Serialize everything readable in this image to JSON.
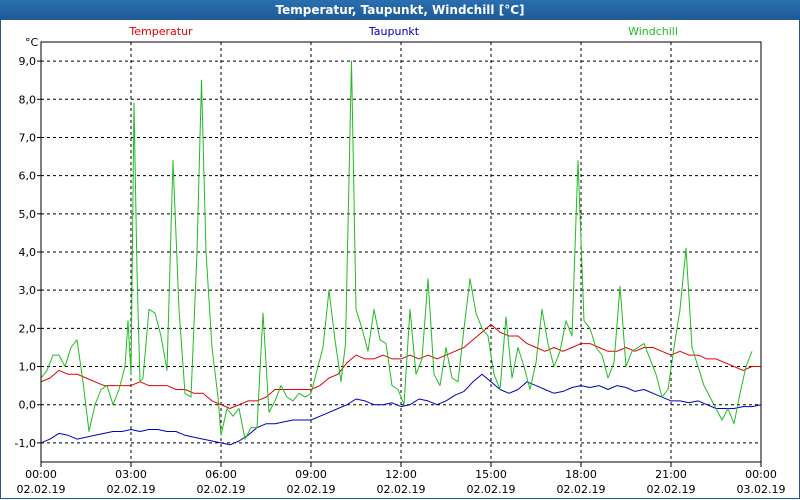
{
  "window": {
    "title": "Temperatur, Taupunkt, Windchill [°C]"
  },
  "chart_data": {
    "type": "line",
    "title": "Temperatur, Taupunkt, Windchill [°C]",
    "ylabel": "°C",
    "ylim": [
      -1.5,
      9.5
    ],
    "yticks": [
      "-1,0",
      "0,0",
      "1,0",
      "2,0",
      "3,0",
      "4,0",
      "5,0",
      "6,0",
      "7,0",
      "8,0",
      "9,0"
    ],
    "xlim": [
      0,
      24
    ],
    "x_ticks": [
      {
        "x": 0,
        "time": "00:00",
        "date": "02.02.19"
      },
      {
        "x": 3,
        "time": "03:00",
        "date": "02.02.19"
      },
      {
        "x": 6,
        "time": "06:00",
        "date": "02.02.19"
      },
      {
        "x": 9,
        "time": "09:00",
        "date": "02.02.19"
      },
      {
        "x": 12,
        "time": "12:00",
        "date": "02.02.19"
      },
      {
        "x": 15,
        "time": "15:00",
        "date": "02.02.19"
      },
      {
        "x": 18,
        "time": "18:00",
        "date": "02.02.19"
      },
      {
        "x": 21,
        "time": "21:00",
        "date": "02.02.19"
      },
      {
        "x": 24,
        "time": "00:00",
        "date": "03.02.19"
      }
    ],
    "grid": true,
    "legend_position": "top",
    "series": [
      {
        "name": "Temperatur",
        "color": "#e00000",
        "points": [
          [
            0,
            0.6
          ],
          [
            0.3,
            0.7
          ],
          [
            0.6,
            0.9
          ],
          [
            0.9,
            0.8
          ],
          [
            1.2,
            0.8
          ],
          [
            1.5,
            0.7
          ],
          [
            1.8,
            0.6
          ],
          [
            2.1,
            0.5
          ],
          [
            2.4,
            0.5
          ],
          [
            2.7,
            0.5
          ],
          [
            3.0,
            0.5
          ],
          [
            3.3,
            0.6
          ],
          [
            3.6,
            0.5
          ],
          [
            3.9,
            0.5
          ],
          [
            4.2,
            0.5
          ],
          [
            4.5,
            0.4
          ],
          [
            4.8,
            0.4
          ],
          [
            5.1,
            0.3
          ],
          [
            5.4,
            0.3
          ],
          [
            5.7,
            0.1
          ],
          [
            6.0,
            0.0
          ],
          [
            6.3,
            -0.1
          ],
          [
            6.6,
            0.0
          ],
          [
            6.9,
            0.1
          ],
          [
            7.2,
            0.1
          ],
          [
            7.5,
            0.2
          ],
          [
            7.8,
            0.4
          ],
          [
            8.1,
            0.4
          ],
          [
            8.4,
            0.4
          ],
          [
            8.7,
            0.4
          ],
          [
            9.0,
            0.4
          ],
          [
            9.3,
            0.5
          ],
          [
            9.6,
            0.7
          ],
          [
            9.9,
            0.8
          ],
          [
            10.2,
            1.1
          ],
          [
            10.5,
            1.3
          ],
          [
            10.8,
            1.2
          ],
          [
            11.1,
            1.2
          ],
          [
            11.4,
            1.3
          ],
          [
            11.7,
            1.2
          ],
          [
            12.0,
            1.2
          ],
          [
            12.3,
            1.3
          ],
          [
            12.6,
            1.2
          ],
          [
            12.9,
            1.3
          ],
          [
            13.2,
            1.2
          ],
          [
            13.5,
            1.3
          ],
          [
            13.8,
            1.4
          ],
          [
            14.1,
            1.5
          ],
          [
            14.4,
            1.7
          ],
          [
            14.7,
            1.9
          ],
          [
            15.0,
            2.1
          ],
          [
            15.3,
            1.9
          ],
          [
            15.6,
            1.8
          ],
          [
            15.9,
            1.8
          ],
          [
            16.2,
            1.6
          ],
          [
            16.5,
            1.5
          ],
          [
            16.8,
            1.4
          ],
          [
            17.1,
            1.5
          ],
          [
            17.4,
            1.4
          ],
          [
            17.7,
            1.5
          ],
          [
            18.0,
            1.6
          ],
          [
            18.3,
            1.6
          ],
          [
            18.6,
            1.5
          ],
          [
            18.9,
            1.4
          ],
          [
            19.2,
            1.4
          ],
          [
            19.5,
            1.5
          ],
          [
            19.8,
            1.4
          ],
          [
            20.1,
            1.5
          ],
          [
            20.4,
            1.5
          ],
          [
            20.7,
            1.4
          ],
          [
            21.0,
            1.3
          ],
          [
            21.3,
            1.4
          ],
          [
            21.6,
            1.3
          ],
          [
            21.9,
            1.3
          ],
          [
            22.2,
            1.2
          ],
          [
            22.5,
            1.2
          ],
          [
            22.8,
            1.1
          ],
          [
            23.1,
            1.0
          ],
          [
            23.4,
            0.9
          ],
          [
            23.7,
            1.0
          ],
          [
            24.0,
            1.0
          ]
        ]
      },
      {
        "name": "Taupunkt",
        "color": "#0000c0",
        "points": [
          [
            0,
            -1.0
          ],
          [
            0.3,
            -0.9
          ],
          [
            0.6,
            -0.75
          ],
          [
            0.9,
            -0.8
          ],
          [
            1.2,
            -0.9
          ],
          [
            1.5,
            -0.85
          ],
          [
            1.8,
            -0.8
          ],
          [
            2.1,
            -0.75
          ],
          [
            2.4,
            -0.7
          ],
          [
            2.7,
            -0.7
          ],
          [
            3.0,
            -0.65
          ],
          [
            3.3,
            -0.7
          ],
          [
            3.6,
            -0.65
          ],
          [
            3.9,
            -0.65
          ],
          [
            4.2,
            -0.7
          ],
          [
            4.5,
            -0.7
          ],
          [
            4.8,
            -0.8
          ],
          [
            5.1,
            -0.85
          ],
          [
            5.4,
            -0.9
          ],
          [
            5.7,
            -0.95
          ],
          [
            6.0,
            -1.0
          ],
          [
            6.3,
            -1.05
          ],
          [
            6.6,
            -0.95
          ],
          [
            6.9,
            -0.8
          ],
          [
            7.2,
            -0.6
          ],
          [
            7.5,
            -0.5
          ],
          [
            7.8,
            -0.5
          ],
          [
            8.1,
            -0.45
          ],
          [
            8.4,
            -0.4
          ],
          [
            8.7,
            -0.4
          ],
          [
            9.0,
            -0.4
          ],
          [
            9.3,
            -0.3
          ],
          [
            9.6,
            -0.2
          ],
          [
            9.9,
            -0.1
          ],
          [
            10.2,
            0.0
          ],
          [
            10.5,
            0.15
          ],
          [
            10.8,
            0.1
          ],
          [
            11.1,
            0.0
          ],
          [
            11.4,
            0.0
          ],
          [
            11.7,
            0.05
          ],
          [
            12.0,
            -0.05
          ],
          [
            12.3,
            0.0
          ],
          [
            12.6,
            0.15
          ],
          [
            12.9,
            0.1
          ],
          [
            13.2,
            0.0
          ],
          [
            13.5,
            0.1
          ],
          [
            13.8,
            0.25
          ],
          [
            14.1,
            0.35
          ],
          [
            14.4,
            0.6
          ],
          [
            14.7,
            0.8
          ],
          [
            15.0,
            0.6
          ],
          [
            15.3,
            0.4
          ],
          [
            15.6,
            0.3
          ],
          [
            15.9,
            0.4
          ],
          [
            16.2,
            0.6
          ],
          [
            16.5,
            0.5
          ],
          [
            16.8,
            0.4
          ],
          [
            17.1,
            0.3
          ],
          [
            17.4,
            0.35
          ],
          [
            17.7,
            0.45
          ],
          [
            18.0,
            0.5
          ],
          [
            18.3,
            0.45
          ],
          [
            18.6,
            0.5
          ],
          [
            18.9,
            0.4
          ],
          [
            19.2,
            0.5
          ],
          [
            19.5,
            0.45
          ],
          [
            19.8,
            0.35
          ],
          [
            20.1,
            0.4
          ],
          [
            20.4,
            0.3
          ],
          [
            20.7,
            0.2
          ],
          [
            21.0,
            0.1
          ],
          [
            21.3,
            0.1
          ],
          [
            21.6,
            0.05
          ],
          [
            21.9,
            0.1
          ],
          [
            22.2,
            0.0
          ],
          [
            22.5,
            -0.1
          ],
          [
            22.8,
            -0.1
          ],
          [
            23.1,
            -0.1
          ],
          [
            23.4,
            -0.05
          ],
          [
            23.7,
            -0.05
          ],
          [
            24.0,
            0.0
          ]
        ]
      },
      {
        "name": "Windchill",
        "color": "#22bb22",
        "points": [
          [
            0,
            0.7
          ],
          [
            0.2,
            0.9
          ],
          [
            0.4,
            1.3
          ],
          [
            0.6,
            1.3
          ],
          [
            0.8,
            1.0
          ],
          [
            1.0,
            1.5
          ],
          [
            1.2,
            1.7
          ],
          [
            1.4,
            0.6
          ],
          [
            1.6,
            -0.7
          ],
          [
            1.8,
            0.0
          ],
          [
            2.0,
            0.4
          ],
          [
            2.2,
            0.5
          ],
          [
            2.4,
            0.0
          ],
          [
            2.6,
            0.4
          ],
          [
            2.8,
            1.0
          ],
          [
            2.9,
            2.2
          ],
          [
            3.0,
            0.8
          ],
          [
            3.1,
            7.9
          ],
          [
            3.2,
            3.5
          ],
          [
            3.3,
            0.6
          ],
          [
            3.4,
            0.7
          ],
          [
            3.6,
            2.5
          ],
          [
            3.8,
            2.4
          ],
          [
            4.0,
            1.8
          ],
          [
            4.2,
            0.9
          ],
          [
            4.4,
            6.4
          ],
          [
            4.6,
            2.5
          ],
          [
            4.8,
            0.3
          ],
          [
            5.0,
            0.2
          ],
          [
            5.2,
            4.0
          ],
          [
            5.35,
            8.5
          ],
          [
            5.5,
            4.0
          ],
          [
            5.7,
            1.5
          ],
          [
            5.9,
            0.2
          ],
          [
            6.0,
            -0.8
          ],
          [
            6.2,
            -0.1
          ],
          [
            6.4,
            -0.3
          ],
          [
            6.6,
            -0.1
          ],
          [
            6.8,
            -0.9
          ],
          [
            7.0,
            -0.6
          ],
          [
            7.2,
            -0.6
          ],
          [
            7.4,
            2.4
          ],
          [
            7.6,
            -0.2
          ],
          [
            7.8,
            0.1
          ],
          [
            8.0,
            0.5
          ],
          [
            8.2,
            0.2
          ],
          [
            8.4,
            0.1
          ],
          [
            8.6,
            0.3
          ],
          [
            8.8,
            0.2
          ],
          [
            9.0,
            0.3
          ],
          [
            9.2,
            0.9
          ],
          [
            9.4,
            1.5
          ],
          [
            9.6,
            3.0
          ],
          [
            9.8,
            1.7
          ],
          [
            10.0,
            0.6
          ],
          [
            10.15,
            1.6
          ],
          [
            10.35,
            9.0
          ],
          [
            10.5,
            2.5
          ],
          [
            10.7,
            2.0
          ],
          [
            10.9,
            1.4
          ],
          [
            11.1,
            2.5
          ],
          [
            11.3,
            1.7
          ],
          [
            11.5,
            1.6
          ],
          [
            11.7,
            0.5
          ],
          [
            11.9,
            0.4
          ],
          [
            12.1,
            0.0
          ],
          [
            12.3,
            2.5
          ],
          [
            12.5,
            0.8
          ],
          [
            12.7,
            1.2
          ],
          [
            12.9,
            3.3
          ],
          [
            13.1,
            0.8
          ],
          [
            13.3,
            0.5
          ],
          [
            13.5,
            1.5
          ],
          [
            13.7,
            0.7
          ],
          [
            13.9,
            0.6
          ],
          [
            14.1,
            2.0
          ],
          [
            14.3,
            3.3
          ],
          [
            14.5,
            2.4
          ],
          [
            14.7,
            2.0
          ],
          [
            14.9,
            1.8
          ],
          [
            15.1,
            0.8
          ],
          [
            15.3,
            0.4
          ],
          [
            15.5,
            2.3
          ],
          [
            15.7,
            0.7
          ],
          [
            15.9,
            1.5
          ],
          [
            16.1,
            1.0
          ],
          [
            16.3,
            0.4
          ],
          [
            16.5,
            1.1
          ],
          [
            16.7,
            2.5
          ],
          [
            16.9,
            1.6
          ],
          [
            17.1,
            1.0
          ],
          [
            17.3,
            1.4
          ],
          [
            17.5,
            2.2
          ],
          [
            17.7,
            1.8
          ],
          [
            17.9,
            6.4
          ],
          [
            18.1,
            2.2
          ],
          [
            18.3,
            2.0
          ],
          [
            18.5,
            1.5
          ],
          [
            18.7,
            1.3
          ],
          [
            18.9,
            0.7
          ],
          [
            19.1,
            1.1
          ],
          [
            19.3,
            3.1
          ],
          [
            19.5,
            1.0
          ],
          [
            19.7,
            1.4
          ],
          [
            19.9,
            1.5
          ],
          [
            20.1,
            1.6
          ],
          [
            20.3,
            1.2
          ],
          [
            20.5,
            0.8
          ],
          [
            20.7,
            0.2
          ],
          [
            20.9,
            0.4
          ],
          [
            21.1,
            1.5
          ],
          [
            21.3,
            2.5
          ],
          [
            21.5,
            4.1
          ],
          [
            21.7,
            1.5
          ],
          [
            21.9,
            1.0
          ],
          [
            22.1,
            0.5
          ],
          [
            22.3,
            0.2
          ],
          [
            22.5,
            -0.1
          ],
          [
            22.7,
            -0.4
          ],
          [
            22.9,
            -0.1
          ],
          [
            23.1,
            -0.5
          ],
          [
            23.3,
            0.3
          ],
          [
            23.5,
            1.0
          ],
          [
            23.7,
            1.4
          ]
        ]
      }
    ]
  }
}
